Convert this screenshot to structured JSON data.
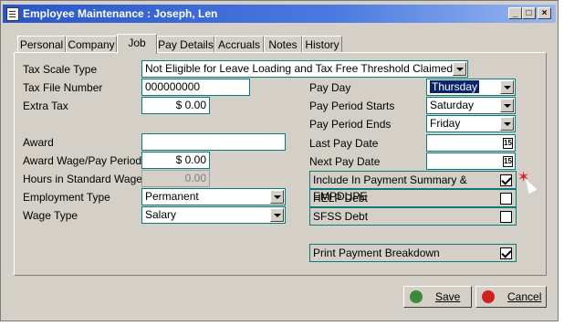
{
  "window": {
    "title": "Employee Maintenance : Joseph, Len"
  },
  "tabs": [
    {
      "label": "Personal"
    },
    {
      "label": "Company"
    },
    {
      "label": "Job"
    },
    {
      "label": "Pay Details"
    },
    {
      "label": "Accruals"
    },
    {
      "label": "Notes"
    },
    {
      "label": "History"
    }
  ],
  "active_tab": "Job",
  "left": {
    "tax_scale_type": {
      "label": "Tax Scale Type",
      "value": "Not Eligible for Leave Loading and Tax Free Threshold Claimed"
    },
    "tax_file_number": {
      "label": "Tax File Number",
      "value": "000000000"
    },
    "extra_tax": {
      "label": "Extra Tax",
      "value": "$ 0.00"
    },
    "award": {
      "label": "Award",
      "value": ""
    },
    "award_wage": {
      "label": "Award Wage/Pay Period",
      "value": "$ 0.00"
    },
    "hours_standard_wage": {
      "label": "Hours in Standard Wage",
      "value": "0.00"
    },
    "employment_type": {
      "label": "Employment Type",
      "value": "Permanent"
    },
    "wage_type": {
      "label": "Wage Type",
      "value": "Salary"
    }
  },
  "right": {
    "pay_day": {
      "label": "Pay Day",
      "value": "Thursday"
    },
    "pay_period_starts": {
      "label": "Pay Period Starts",
      "value": "Saturday"
    },
    "pay_period_ends": {
      "label": "Pay Period Ends",
      "value": "Friday"
    },
    "last_pay_date": {
      "label": "Last Pay Date",
      "value": ""
    },
    "next_pay_date": {
      "label": "Next Pay Date",
      "value": ""
    }
  },
  "checkboxes": {
    "include_payment_summary": {
      "label": "Include In Payment Summary & EMPDUPE",
      "checked": true
    },
    "help_debt": {
      "label": "HELP Debt",
      "checked": false
    },
    "sfss_debt": {
      "label": "SFSS Debt",
      "checked": false
    },
    "print_payment_breakdown": {
      "label": "Print Payment Breakdown",
      "checked": true
    }
  },
  "buttons": {
    "save": "Save",
    "cancel": "Cancel"
  },
  "colors": {
    "titlebar": "#2a55c8",
    "field_border": "#0a7a7a",
    "selection": "#0a246a",
    "dialog_bg": "#d4d0c8"
  }
}
